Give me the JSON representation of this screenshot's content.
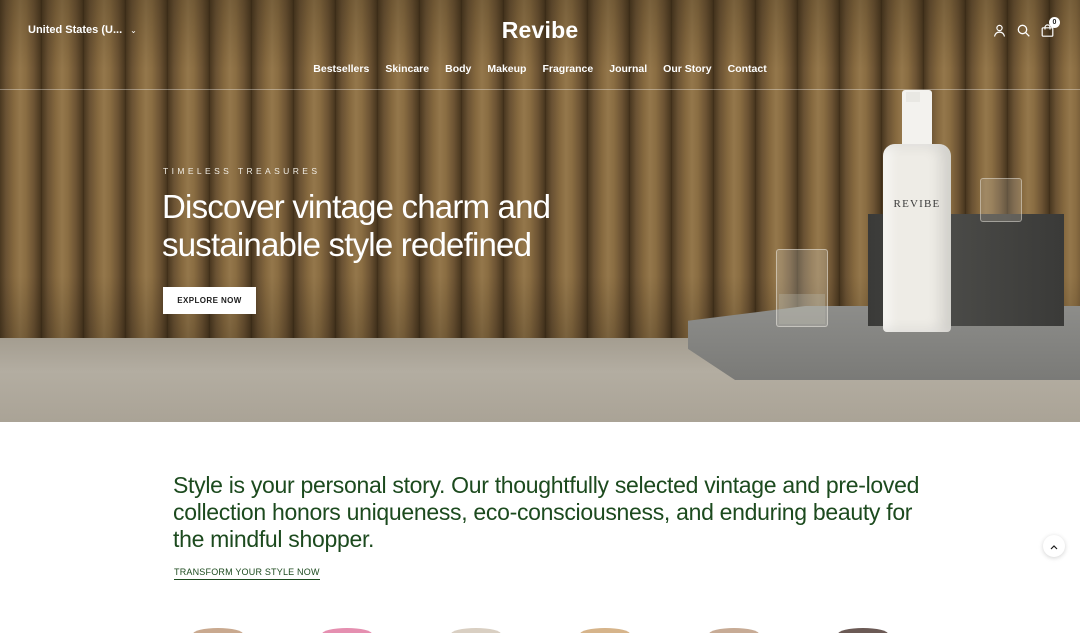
{
  "header": {
    "country": "United States (U...",
    "logo": "Revibe",
    "nav": [
      "Bestsellers",
      "Skincare",
      "Body",
      "Makeup",
      "Fragrance",
      "Journal",
      "Our Story",
      "Contact"
    ],
    "cart_count": "0",
    "icons": [
      "user-icon",
      "search-icon",
      "cart-icon"
    ]
  },
  "hero": {
    "eyebrow": "TIMELESS TREASURES",
    "headline": "Discover vintage charm and sustainable style redefined",
    "cta": "EXPLORE NOW",
    "product_label": "REVIBE"
  },
  "intro": {
    "text": "Style is your personal story. Our thoughtfully selected vintage and pre-loved collection honors uniqueness, eco-consciousness, and enduring beauty for the mindful shopper.",
    "link": "TRANSFORM YOUR STYLE NOW"
  },
  "colors": {
    "accent_green": "#1c4a1e",
    "hero_wall": "#86693f"
  }
}
